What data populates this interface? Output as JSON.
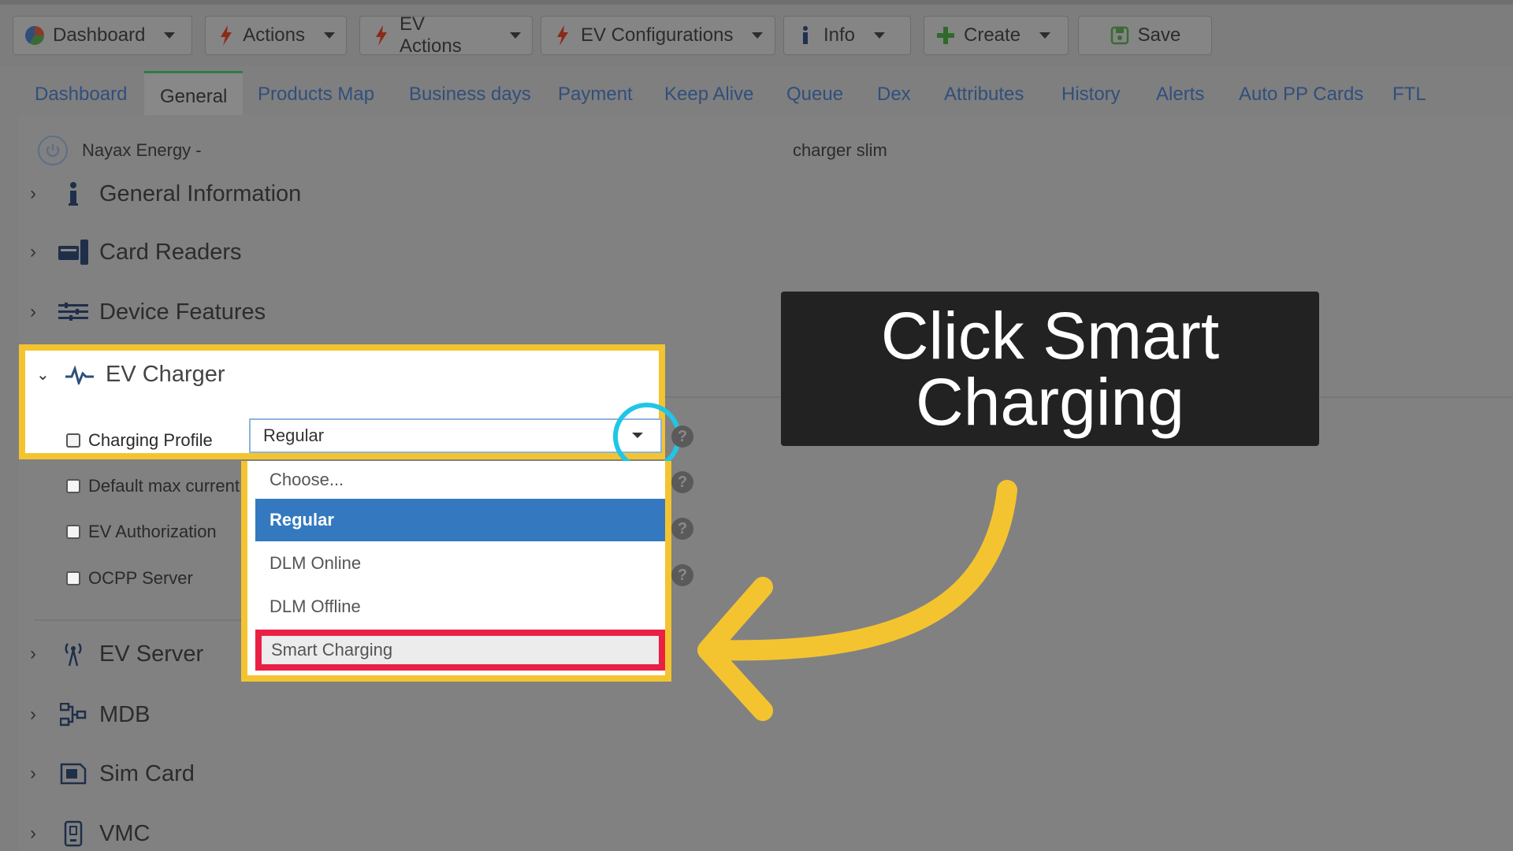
{
  "toolbar": {
    "dashboard": "Dashboard",
    "actions": "Actions",
    "ev_actions": "EV Actions",
    "ev_configurations": "EV Configurations",
    "info": "Info",
    "create": "Create",
    "save": "Save"
  },
  "tabs": [
    "Dashboard",
    "General",
    "Products Map",
    "Business days",
    "Payment",
    "Keep Alive",
    "Queue",
    "Dex",
    "Attributes",
    "History",
    "Alerts",
    "Auto PP Cards",
    "FTL"
  ],
  "active_tab": "General",
  "header": {
    "left": "Nayax Energy -",
    "right": "charger slim"
  },
  "sections": {
    "general_information": "General Information",
    "card_readers": "Card Readers",
    "device_features": "Device Features",
    "ev_charger": "EV Charger",
    "ev_server": "EV Server",
    "mdb": "MDB",
    "sim_card": "Sim Card",
    "vmc": "VMC"
  },
  "ev_charger": {
    "fields": [
      "Charging Profile",
      "Default max current",
      "EV Authorization",
      "OCPP Server"
    ],
    "charging_profile_value": "Regular",
    "options": [
      "Choose...",
      "Regular",
      "DLM Online",
      "DLM Offline",
      "Smart Charging"
    ],
    "selected_option": "Regular",
    "target_option": "Smart Charging"
  },
  "help_glyph": "?",
  "callout": {
    "line1": "Click Smart",
    "line2": "Charging"
  },
  "colors": {
    "highlight_yellow": "#f4c430",
    "target_red": "#ea1f45",
    "ring_cyan": "#1fc6e6",
    "selected_blue": "#3479c0",
    "callout_bg": "#222222"
  }
}
